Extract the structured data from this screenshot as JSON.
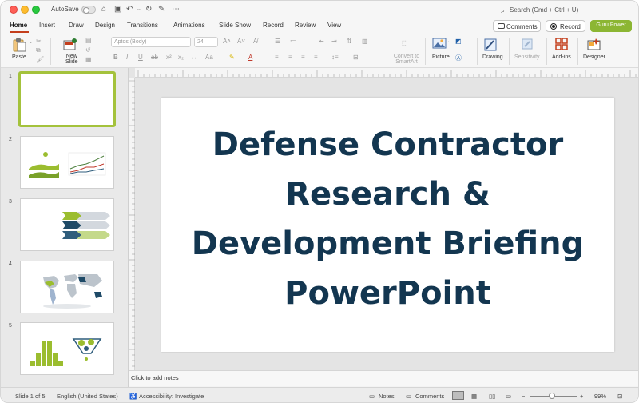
{
  "titlebar": {
    "autosave_label": "AutoSave",
    "search_text": "Search (Cmd + Ctrl + U)"
  },
  "tabs": [
    "Home",
    "Insert",
    "Draw",
    "Design",
    "Transitions",
    "Animations",
    "Slide Show",
    "Record",
    "Review",
    "View"
  ],
  "actions": {
    "comments": "Comments",
    "record": "Record",
    "guru": "Guru Power"
  },
  "ribbon": {
    "paste": "Paste",
    "new_slide": [
      "New",
      "Slide"
    ],
    "font_name": "Aptos (Body)",
    "font_size": "24",
    "convert": [
      "Convert to",
      "SmartArt"
    ],
    "picture": "Picture",
    "drawing": "Drawing",
    "sensitivity": "Sensitivity",
    "addins": "Add-ins",
    "designer": "Designer"
  },
  "colors": {
    "accent": "#c43e1c",
    "brand_green": "#8cb633",
    "title_navy": "#133650"
  },
  "slides": [
    {
      "number": "1"
    },
    {
      "number": "2"
    },
    {
      "number": "3"
    },
    {
      "number": "4"
    },
    {
      "number": "5"
    }
  ],
  "slide": {
    "title_lines": [
      "Defense Contractor",
      "Research &",
      "Development Briefing",
      "PowerPoint"
    ]
  },
  "notes_placeholder": "Click to add notes",
  "status": {
    "slide_count": "Slide 1 of 5",
    "language": "English (United States)",
    "accessibility": "Accessibility: Investigate",
    "notes": "Notes",
    "comments": "Comments",
    "zoom": "99%"
  }
}
